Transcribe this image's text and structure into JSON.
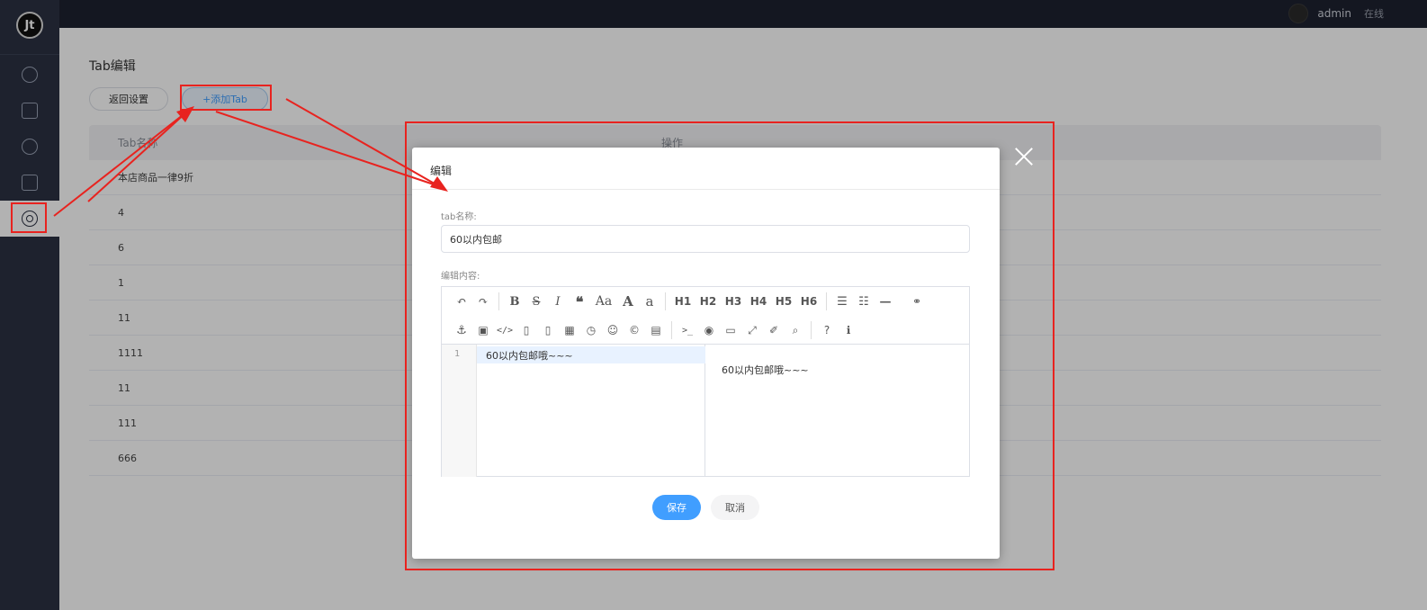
{
  "header": {
    "username": "admin",
    "status": "在线"
  },
  "sidebar": {
    "logo": "Jt",
    "items": [
      {
        "name": "home",
        "icon": "home-icon"
      },
      {
        "name": "orders",
        "icon": "orders-icon"
      },
      {
        "name": "products",
        "icon": "products-icon"
      },
      {
        "name": "shop",
        "icon": "shop-icon"
      },
      {
        "name": "settings",
        "icon": "settings-icon",
        "active": true
      }
    ]
  },
  "page": {
    "title": "Tab编辑",
    "back_label": "返回设置",
    "add_label": "+添加Tab"
  },
  "table": {
    "headers": [
      "Tab名称",
      "操作"
    ],
    "rows": [
      "本店商品一律9折",
      "4",
      "6",
      "1",
      "11",
      "1111",
      "11",
      "111",
      "666"
    ]
  },
  "modal": {
    "title": "编辑",
    "name_label": "tab名称:",
    "name_value": "60以内包邮",
    "content_label": "编辑内容:",
    "toolbar_row1": [
      "undo-icon",
      "redo-icon",
      "bold-icon",
      "strikethrough-icon",
      "italic-icon",
      "quote-icon",
      "uppercase-icon",
      "uppercase-first-icon",
      "lowercase-icon",
      "h1",
      "h2",
      "h3",
      "h4",
      "h5",
      "h6",
      "list-ul-icon",
      "list-ol-icon",
      "hr-icon",
      "link-icon"
    ],
    "toolbar_row2": [
      "anchor-icon",
      "image-icon",
      "code-icon",
      "preformatted-code-icon",
      "code-block-icon",
      "table-icon",
      "datetime-icon",
      "emoji-icon",
      "html-entities-icon",
      "pagebreak-icon",
      "goto-line-icon",
      "watch-icon",
      "preview-icon",
      "fullscreen-icon",
      "clear-icon",
      "search-icon",
      "help-icon",
      "info-icon"
    ],
    "toolbar_labels": {
      "h1": "H1",
      "h2": "H2",
      "h3": "H3",
      "h4": "H4",
      "h5": "H5",
      "h6": "H6"
    },
    "editor": {
      "line_number": "1",
      "code": "60以内包邮哦~~~",
      "preview": "60以内包邮哦~~~"
    },
    "save_label": "保存",
    "cancel_label": "取消"
  },
  "annotation_color": "#e8231f"
}
